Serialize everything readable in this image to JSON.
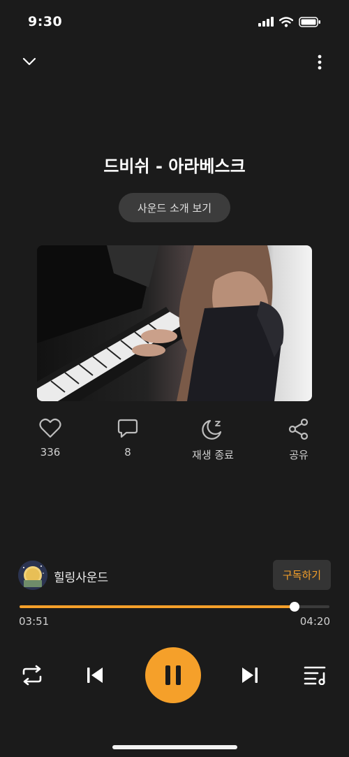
{
  "status_bar": {
    "time": "9:30"
  },
  "player": {
    "title": "드비쉬 - 아라베스크",
    "intro_button": "사운드 소개 보기"
  },
  "actions": {
    "like": {
      "count": "336",
      "icon": "heart-icon"
    },
    "comment": {
      "count": "8",
      "icon": "comment-icon"
    },
    "sleep_timer": {
      "label": "재생 종료",
      "icon": "moon-icon"
    },
    "share": {
      "label": "공유",
      "icon": "share-icon"
    }
  },
  "channel": {
    "name": "힐링사운드",
    "subscribe_button": "구독하기"
  },
  "playback": {
    "current_time": "03:51",
    "total_time": "04:20",
    "progress": 0.888
  },
  "colors": {
    "accent": "#f5a02a",
    "background": "#1b1b1b"
  }
}
